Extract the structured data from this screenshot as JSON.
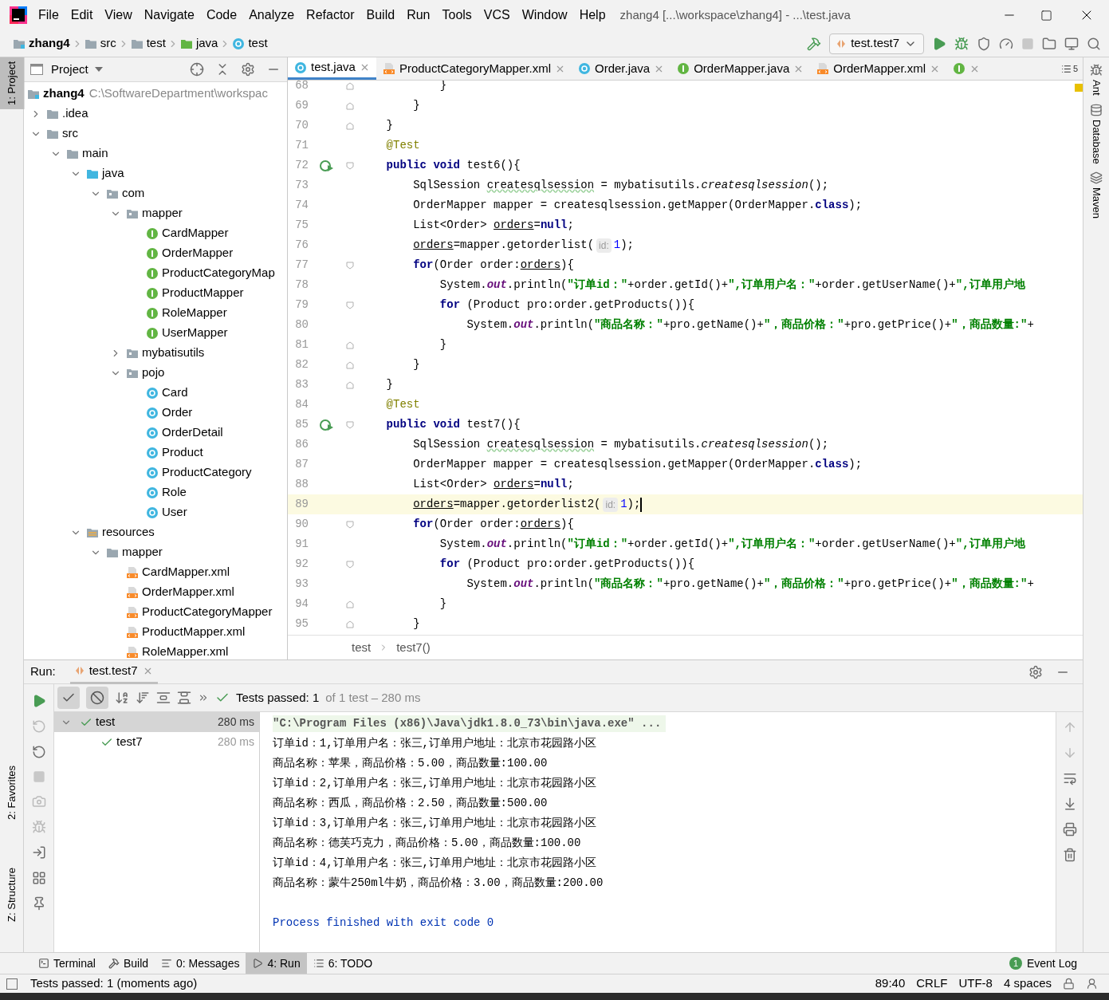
{
  "menu": [
    "File",
    "Edit",
    "View",
    "Navigate",
    "Code",
    "Analyze",
    "Refactor",
    "Build",
    "Run",
    "Tools",
    "VCS",
    "Window",
    "Help"
  ],
  "window_title": "zhang4 [...\\workspace\\zhang4] - ...\\test.java",
  "breadcrumb": [
    {
      "label": "zhang4",
      "kind": "module"
    },
    {
      "label": "src",
      "kind": "folder"
    },
    {
      "label": "test",
      "kind": "folder"
    },
    {
      "label": "java",
      "kind": "test-folder"
    },
    {
      "label": "test",
      "kind": "class"
    }
  ],
  "run_config": "test.test7",
  "left_stripe": [
    {
      "label": "1: Project",
      "selected": true
    },
    {
      "label": "2: Favorites",
      "selected": false
    },
    {
      "label": "Z: Structure",
      "selected": false
    }
  ],
  "right_stripe": [
    "Ant",
    "Database",
    "Maven"
  ],
  "project_panel": {
    "title": "Project",
    "tree": [
      {
        "label": "zhang4",
        "path": "C:\\SoftwareDepartment\\workspac",
        "kind": "module",
        "children": [
          {
            "label": ".idea",
            "kind": "folder",
            "expanded": false
          },
          {
            "label": "src",
            "kind": "folder",
            "expanded": true,
            "children": [
              {
                "label": "main",
                "kind": "folder",
                "expanded": true,
                "children": [
                  {
                    "label": "java",
                    "kind": "source-folder",
                    "expanded": true,
                    "children": [
                      {
                        "label": "com",
                        "kind": "package",
                        "expanded": true,
                        "children": [
                          {
                            "label": "mapper",
                            "kind": "package",
                            "expanded": true,
                            "children": [
                              {
                                "label": "CardMapper",
                                "kind": "interface"
                              },
                              {
                                "label": "OrderMapper",
                                "kind": "interface"
                              },
                              {
                                "label": "ProductCategoryMap",
                                "kind": "interface"
                              },
                              {
                                "label": "ProductMapper",
                                "kind": "interface"
                              },
                              {
                                "label": "RoleMapper",
                                "kind": "interface"
                              },
                              {
                                "label": "UserMapper",
                                "kind": "interface"
                              }
                            ]
                          },
                          {
                            "label": "mybatisutils",
                            "kind": "package",
                            "expanded": false
                          },
                          {
                            "label": "pojo",
                            "kind": "package",
                            "expanded": true,
                            "children": [
                              {
                                "label": "Card",
                                "kind": "class"
                              },
                              {
                                "label": "Order",
                                "kind": "class"
                              },
                              {
                                "label": "OrderDetail",
                                "kind": "class"
                              },
                              {
                                "label": "Product",
                                "kind": "class"
                              },
                              {
                                "label": "ProductCategory",
                                "kind": "class"
                              },
                              {
                                "label": "Role",
                                "kind": "class"
                              },
                              {
                                "label": "User",
                                "kind": "class"
                              }
                            ]
                          }
                        ]
                      }
                    ]
                  },
                  {
                    "label": "resources",
                    "kind": "resource-folder",
                    "expanded": true,
                    "children": [
                      {
                        "label": "mapper",
                        "kind": "folder",
                        "expanded": true,
                        "children": [
                          {
                            "label": "CardMapper.xml",
                            "kind": "xml"
                          },
                          {
                            "label": "OrderMapper.xml",
                            "kind": "xml"
                          },
                          {
                            "label": "ProductCategoryMapper",
                            "kind": "xml"
                          },
                          {
                            "label": "ProductMapper.xml",
                            "kind": "xml"
                          },
                          {
                            "label": "RoleMapper.xml",
                            "kind": "xml"
                          }
                        ]
                      }
                    ]
                  }
                ]
              }
            ]
          }
        ]
      }
    ]
  },
  "editor": {
    "tabs": [
      {
        "label": "test.java",
        "kind": "class",
        "selected": true
      },
      {
        "label": "ProductCategoryMapper.xml",
        "kind": "xml",
        "selected": false
      },
      {
        "label": "Order.java",
        "kind": "class",
        "selected": false
      },
      {
        "label": "OrderMapper.java",
        "kind": "interface",
        "selected": false
      },
      {
        "label": "OrderMapper.xml",
        "kind": "xml",
        "selected": false
      },
      {
        "kind": "interface",
        "selected": false
      }
    ],
    "tab_count": "5",
    "lines": [
      {
        "number": "68",
        "kind": "fold-end",
        "run": false,
        "current": false,
        "tokens": [
          {
            "kind": "plain",
            "text": "            }"
          }
        ]
      },
      {
        "number": "69",
        "kind": "fold-end",
        "run": false,
        "current": false,
        "tokens": [
          {
            "kind": "plain",
            "text": "        }"
          }
        ]
      },
      {
        "number": "70",
        "kind": "fold-end",
        "run": false,
        "current": false,
        "tokens": [
          {
            "kind": "plain",
            "text": "    }"
          }
        ]
      },
      {
        "number": "71",
        "kind": "plain",
        "run": false,
        "current": false,
        "tokens": [
          {
            "kind": "annotation",
            "text": "    @Test"
          }
        ]
      },
      {
        "number": "72",
        "kind": "fold-start",
        "run": true,
        "current": false,
        "tokens": [
          {
            "kind": "keyword",
            "text": "    public void"
          },
          {
            "kind": "plain",
            "text": " test6(){"
          }
        ]
      },
      {
        "number": "73",
        "kind": "plain",
        "run": false,
        "current": false,
        "tokens": [
          {
            "kind": "plain",
            "text": "        SqlSession "
          },
          {
            "kind": "warning",
            "text": "createsqlsession"
          },
          {
            "kind": "plain",
            "text": " = mybatisutils."
          },
          {
            "kind": "static",
            "text": "createsqlsession"
          },
          {
            "kind": "plain",
            "text": "();"
          }
        ]
      },
      {
        "number": "74",
        "kind": "plain",
        "run": false,
        "current": false,
        "tokens": [
          {
            "kind": "plain",
            "text": "        OrderMapper mapper = createsqlsession.getMapper(OrderMapper."
          },
          {
            "kind": "keyword",
            "text": "class"
          },
          {
            "kind": "plain",
            "text": ");"
          }
        ]
      },
      {
        "number": "75",
        "kind": "plain",
        "run": false,
        "current": false,
        "tokens": [
          {
            "kind": "plain",
            "text": "        List<Order> "
          },
          {
            "kind": "reassigned",
            "text": "orders"
          },
          {
            "kind": "plain",
            "text": "="
          },
          {
            "kind": "keyword",
            "text": "null"
          },
          {
            "kind": "plain",
            "text": ";"
          }
        ]
      },
      {
        "number": "76",
        "kind": "plain",
        "run": false,
        "current": false,
        "tokens": [
          {
            "kind": "reassigned",
            "text": "        orders"
          },
          {
            "kind": "plain",
            "text": "=mapper.getorderlist("
          },
          {
            "kind": "hint",
            "text": "id:"
          },
          {
            "kind": "number",
            "text": "1"
          },
          {
            "kind": "plain",
            "text": ");"
          }
        ]
      },
      {
        "number": "77",
        "kind": "fold-start",
        "run": false,
        "current": false,
        "tokens": [
          {
            "kind": "keyword",
            "text": "        for"
          },
          {
            "kind": "plain",
            "text": "(Order order:"
          },
          {
            "kind": "reassigned",
            "text": "orders"
          },
          {
            "kind": "plain",
            "text": "){"
          }
        ]
      },
      {
        "number": "78",
        "kind": "plain",
        "run": false,
        "current": false,
        "tokens": [
          {
            "kind": "plain",
            "text": "            System."
          },
          {
            "kind": "field",
            "text": "out"
          },
          {
            "kind": "plain",
            "text": ".println("
          },
          {
            "kind": "string",
            "text": "\"订单id：\""
          },
          {
            "kind": "plain",
            "text": "+order.getId()+"
          },
          {
            "kind": "string",
            "text": "\",订单用户名：\""
          },
          {
            "kind": "plain",
            "text": "+order.getUserName()+"
          },
          {
            "kind": "string",
            "text": "\",订单用户地"
          }
        ]
      },
      {
        "number": "79",
        "kind": "fold-start",
        "run": false,
        "current": false,
        "tokens": [
          {
            "kind": "keyword",
            "text": "            for"
          },
          {
            "kind": "plain",
            "text": " (Product pro:order.getProducts()){"
          }
        ]
      },
      {
        "number": "80",
        "kind": "plain",
        "run": false,
        "current": false,
        "tokens": [
          {
            "kind": "plain",
            "text": "                System."
          },
          {
            "kind": "field",
            "text": "out"
          },
          {
            "kind": "plain",
            "text": ".println("
          },
          {
            "kind": "string",
            "text": "\"商品名称：\""
          },
          {
            "kind": "plain",
            "text": "+pro.getName()+"
          },
          {
            "kind": "string",
            "text": "\"，商品价格：\""
          },
          {
            "kind": "plain",
            "text": "+pro.getPrice()+"
          },
          {
            "kind": "string",
            "text": "\"，商品数量:\""
          },
          {
            "kind": "plain",
            "text": "+"
          }
        ]
      },
      {
        "number": "81",
        "kind": "fold-end",
        "run": false,
        "current": false,
        "tokens": [
          {
            "kind": "plain",
            "text": "            }"
          }
        ]
      },
      {
        "number": "82",
        "kind": "fold-end",
        "run": false,
        "current": false,
        "tokens": [
          {
            "kind": "plain",
            "text": "        }"
          }
        ]
      },
      {
        "number": "83",
        "kind": "fold-end",
        "run": false,
        "current": false,
        "tokens": [
          {
            "kind": "plain",
            "text": "    }"
          }
        ]
      },
      {
        "number": "84",
        "kind": "plain",
        "run": false,
        "current": false,
        "tokens": [
          {
            "kind": "annotation",
            "text": "    @Test"
          }
        ]
      },
      {
        "number": "85",
        "kind": "fold-start",
        "run": true,
        "current": false,
        "tokens": [
          {
            "kind": "keyword",
            "text": "    public void"
          },
          {
            "kind": "plain",
            "text": " test7(){"
          }
        ]
      },
      {
        "number": "86",
        "kind": "plain",
        "run": false,
        "current": false,
        "tokens": [
          {
            "kind": "plain",
            "text": "        SqlSession "
          },
          {
            "kind": "warning",
            "text": "createsqlsession"
          },
          {
            "kind": "plain",
            "text": " = mybatisutils."
          },
          {
            "kind": "static",
            "text": "createsqlsession"
          },
          {
            "kind": "plain",
            "text": "();"
          }
        ]
      },
      {
        "number": "87",
        "kind": "plain",
        "run": false,
        "current": false,
        "tokens": [
          {
            "kind": "plain",
            "text": "        OrderMapper mapper = createsqlsession.getMapper(OrderMapper."
          },
          {
            "kind": "keyword",
            "text": "class"
          },
          {
            "kind": "plain",
            "text": ");"
          }
        ]
      },
      {
        "number": "88",
        "kind": "plain",
        "run": false,
        "current": false,
        "tokens": [
          {
            "kind": "plain",
            "text": "        List<Order> "
          },
          {
            "kind": "reassigned",
            "text": "orders"
          },
          {
            "kind": "plain",
            "text": "="
          },
          {
            "kind": "keyword",
            "text": "null"
          },
          {
            "kind": "plain",
            "text": ";"
          }
        ]
      },
      {
        "number": "89",
        "kind": "plain",
        "run": false,
        "current": true,
        "tokens": [
          {
            "kind": "reassigned",
            "text": "        orders"
          },
          {
            "kind": "plain",
            "text": "=mapper.getorderlist2("
          },
          {
            "kind": "hint",
            "text": "id:"
          },
          {
            "kind": "number",
            "text": "1"
          },
          {
            "kind": "plain",
            "text": ");"
          }
        ]
      },
      {
        "number": "90",
        "kind": "fold-start",
        "run": false,
        "current": false,
        "tokens": [
          {
            "kind": "keyword",
            "text": "        for"
          },
          {
            "kind": "plain",
            "text": "(Order order:"
          },
          {
            "kind": "reassigned",
            "text": "orders"
          },
          {
            "kind": "plain",
            "text": "){"
          }
        ]
      },
      {
        "number": "91",
        "kind": "plain",
        "run": false,
        "current": false,
        "tokens": [
          {
            "kind": "plain",
            "text": "            System."
          },
          {
            "kind": "field",
            "text": "out"
          },
          {
            "kind": "plain",
            "text": ".println("
          },
          {
            "kind": "string",
            "text": "\"订单id：\""
          },
          {
            "kind": "plain",
            "text": "+order.getId()+"
          },
          {
            "kind": "string",
            "text": "\",订单用户名：\""
          },
          {
            "kind": "plain",
            "text": "+order.getUserName()+"
          },
          {
            "kind": "string",
            "text": "\",订单用户地"
          }
        ]
      },
      {
        "number": "92",
        "kind": "fold-start",
        "run": false,
        "current": false,
        "tokens": [
          {
            "kind": "keyword",
            "text": "            for"
          },
          {
            "kind": "plain",
            "text": " (Product pro:order.getProducts()){"
          }
        ]
      },
      {
        "number": "93",
        "kind": "plain",
        "run": false,
        "current": false,
        "tokens": [
          {
            "kind": "plain",
            "text": "                System."
          },
          {
            "kind": "field",
            "text": "out"
          },
          {
            "kind": "plain",
            "text": ".println("
          },
          {
            "kind": "string",
            "text": "\"商品名称：\""
          },
          {
            "kind": "plain",
            "text": "+pro.getName()+"
          },
          {
            "kind": "string",
            "text": "\"，商品价格：\""
          },
          {
            "kind": "plain",
            "text": "+pro.getPrice()+"
          },
          {
            "kind": "string",
            "text": "\"，商品数量:\""
          },
          {
            "kind": "plain",
            "text": "+"
          }
        ]
      },
      {
        "number": "94",
        "kind": "fold-end",
        "run": false,
        "current": false,
        "tokens": [
          {
            "kind": "plain",
            "text": "            }"
          }
        ]
      },
      {
        "number": "95",
        "kind": "fold-end",
        "run": false,
        "current": false,
        "tokens": [
          {
            "kind": "plain",
            "text": "        }"
          }
        ]
      }
    ],
    "breadcrumb": [
      "test",
      "test7()"
    ]
  },
  "run_panel": {
    "label": "Run:",
    "tab": "test.test7",
    "filters": [
      {
        "kind": "passed",
        "selected": true
      },
      {
        "kind": "ignored",
        "selected": true
      }
    ],
    "status": "Tests passed: 1",
    "status_detail": "of 1 test – 280 ms",
    "tests": [
      {
        "name": "test",
        "time": "280 ms",
        "selected": true,
        "children": [
          {
            "name": "test7",
            "time": "280 ms",
            "selected": false
          }
        ]
      }
    ],
    "console": [
      {
        "kind": "command",
        "text": "\"C:\\Program Files (x86)\\Java\\jdk1.8.0_73\\bin\\java.exe\" ..."
      },
      {
        "kind": "output",
        "text": "订单id：1,订单用户名：张三,订单用户地址：北京市花园路小区"
      },
      {
        "kind": "output",
        "text": "商品名称：苹果，商品价格：5.00，商品数量:100.00"
      },
      {
        "kind": "output",
        "text": "订单id：2,订单用户名：张三,订单用户地址：北京市花园路小区"
      },
      {
        "kind": "output",
        "text": "商品名称：西瓜，商品价格：2.50，商品数量:500.00"
      },
      {
        "kind": "output",
        "text": "订单id：3,订单用户名：张三,订单用户地址：北京市花园路小区"
      },
      {
        "kind": "output",
        "text": "商品名称：德芙巧克力，商品价格：5.00，商品数量:100.00"
      },
      {
        "kind": "output",
        "text": "订单id：4,订单用户名：张三,订单用户地址：北京市花园路小区"
      },
      {
        "kind": "output",
        "text": "商品名称：蒙牛250ml牛奶，商品价格：3.00，商品数量:200.00"
      },
      {
        "kind": "exit",
        "text": "Process finished with exit code 0"
      }
    ]
  },
  "tool_windows": [
    {
      "label": "Terminal",
      "kind": "terminal",
      "selected": false
    },
    {
      "label": "Build",
      "kind": "build",
      "selected": false
    },
    {
      "label": "0: Messages",
      "kind": "messages",
      "selected": false
    },
    {
      "label": "4: Run",
      "kind": "run",
      "selected": true
    },
    {
      "label": "6: TODO",
      "kind": "todo",
      "selected": false
    }
  ],
  "event_log": {
    "label": "Event Log",
    "count": "1"
  },
  "status_bar": {
    "message": "Tests passed: 1 (moments ago)",
    "items": [
      "89:40",
      "CRLF",
      "UTF-8",
      "4 spaces"
    ]
  }
}
